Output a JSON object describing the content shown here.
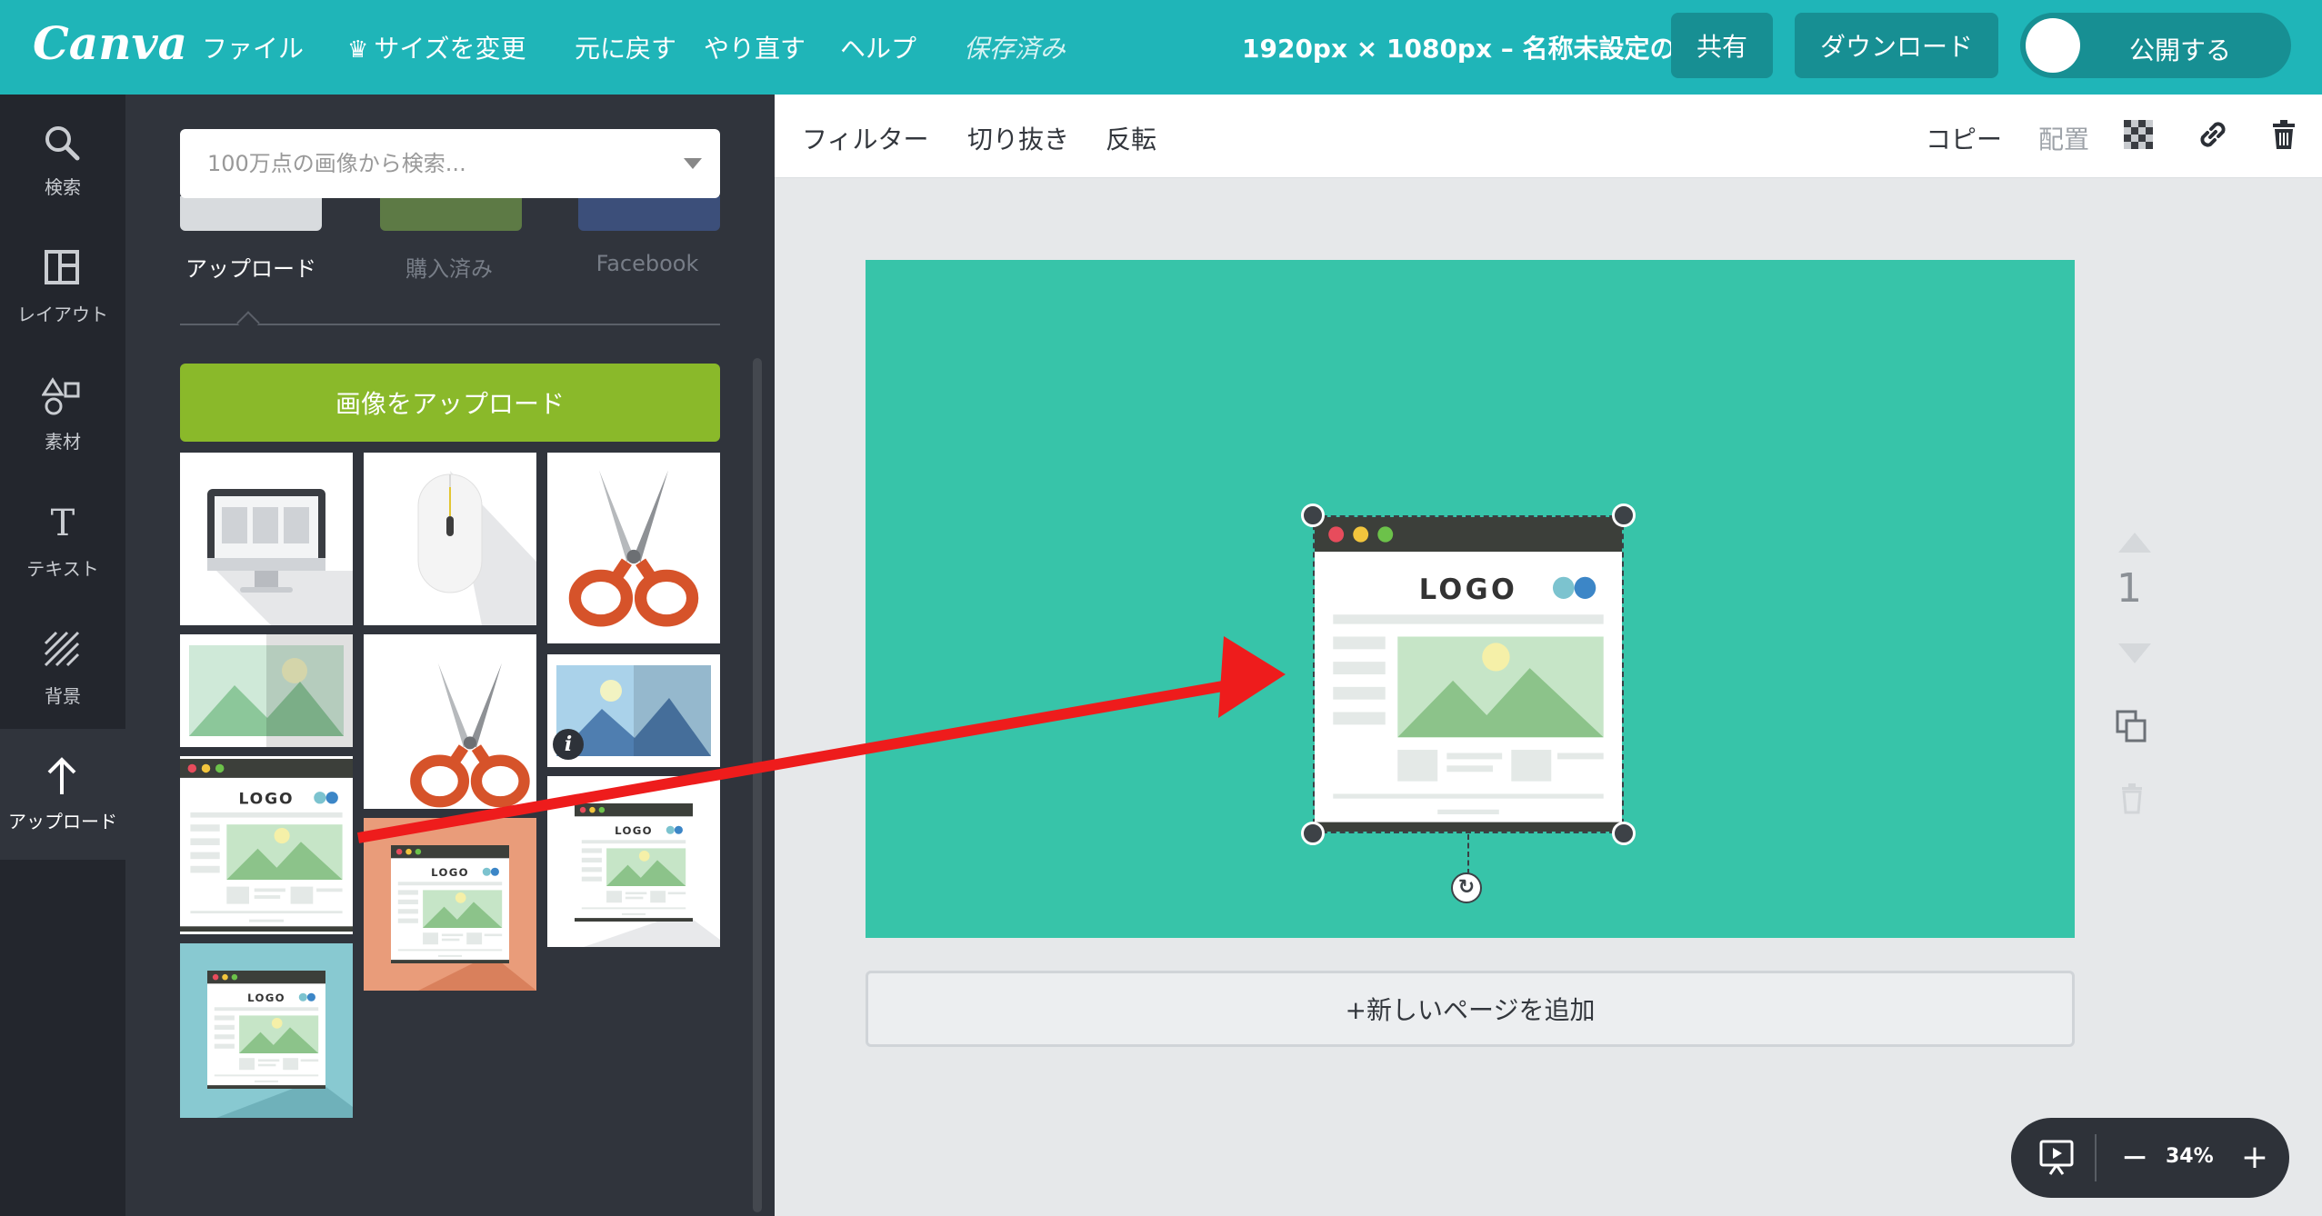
{
  "header": {
    "logo": "Canva",
    "menu": {
      "file": "ファイル",
      "resize": "サイズを変更",
      "undo": "元に戻す",
      "redo": "やり直す",
      "help": "ヘルプ",
      "saved": "保存済み"
    },
    "doc_title": "1920px × 1080px – 名称未設定の…",
    "share": "共有",
    "download": "ダウンロード",
    "publish": "公開する"
  },
  "rail": {
    "search": "検索",
    "layout": "レイアウト",
    "elements": "素材",
    "text": "テキスト",
    "background": "背景",
    "uploads": "アップロード"
  },
  "panel": {
    "search_placeholder": "100万点の画像から検索...",
    "categories": [
      "アップロード",
      "購入済み",
      "Facebook"
    ],
    "upload_button": "画像をアップロード",
    "tile_logo_text": "LOGO"
  },
  "toolbar": {
    "filter": "フィルター",
    "crop": "切り抜き",
    "flip": "反転",
    "copy": "コピー",
    "arrange": "配置"
  },
  "canvas": {
    "artboard_color": "#37c4a9",
    "selected_logo_text": "LOGO",
    "add_page": "+新しいページを追加",
    "page_number": "1"
  },
  "zoom": {
    "minus": "−",
    "level": "34%",
    "plus": "+"
  },
  "colors": {
    "brand": "#1fb5b8",
    "upload_green": "#8ab92a",
    "annotation_arrow": "#ee1c1c"
  }
}
